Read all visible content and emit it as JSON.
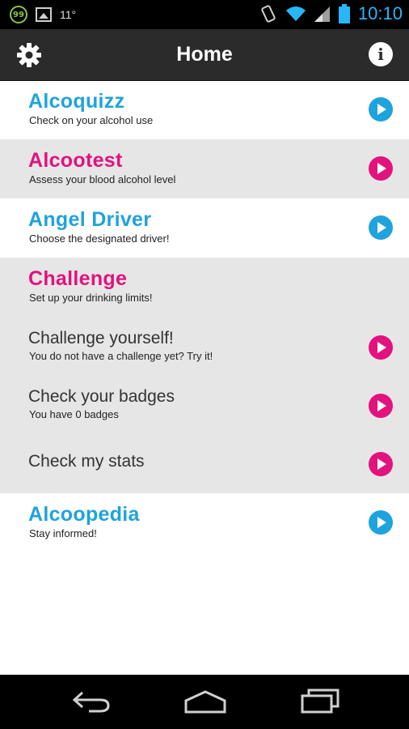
{
  "status_bar": {
    "notification_badge": "99",
    "temperature": "11°",
    "time": "10:10"
  },
  "action_bar": {
    "title": "Home",
    "settings_icon": "gear-icon",
    "info_icon": "info-icon"
  },
  "sections": [
    {
      "title": "Alcoquizz",
      "subtitle": "Check on your alcohol use",
      "color": "#1fa3dd"
    },
    {
      "title": "Alcootest",
      "subtitle": "Assess your blood alcohol level",
      "color": "#e2127f"
    },
    {
      "title": "Angel Driver",
      "subtitle": "Choose the designated driver!",
      "color": "#1fa3dd"
    },
    {
      "title": "Challenge",
      "subtitle": "Set up your drinking limits!",
      "color": "#e2127f"
    }
  ],
  "challenge_items": [
    {
      "title": "Challenge yourself!",
      "subtitle": "You do not have a challenge yet? Try it!"
    },
    {
      "title": "Check your badges",
      "subtitle": "You have 0 badges"
    },
    {
      "title": "Check my stats",
      "subtitle": ""
    }
  ],
  "last_section": {
    "title": "Alcoopedia",
    "subtitle": "Stay informed!",
    "color": "#1fa3dd"
  },
  "nav_bar": {
    "back_icon": "back-icon",
    "home_icon": "home-icon",
    "recents_icon": "recent-apps-icon"
  }
}
